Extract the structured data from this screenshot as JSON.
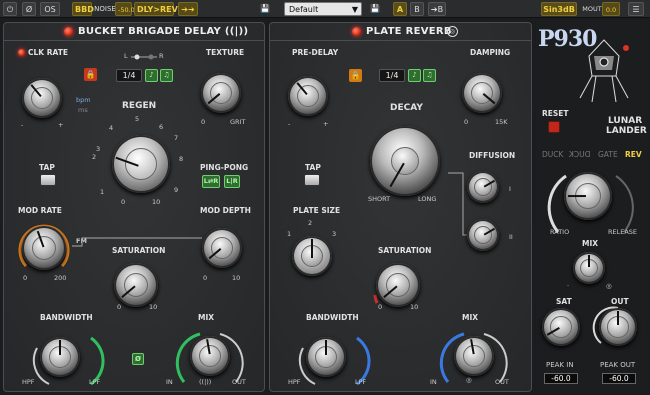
{
  "topbar": {
    "power": "⏻",
    "phase": "Ø",
    "os": "OS",
    "bbd": "BBD",
    "noise_label": "NOISE",
    "noise_value": "-50.0",
    "dly_rev": "DLY>REV",
    "routing": "➔➔",
    "save": "💾",
    "preset": "Default",
    "preset_arrow": "▼",
    "save2": "💾",
    "a": "A",
    "b": "B",
    "ab": "➔B",
    "sin": "Sin3dB",
    "mout_label": "MOUT",
    "mout_value": "0.0"
  },
  "bbd": {
    "title": "BUCKET BRIGADE DELAY ((|))",
    "clk_rate": "CLK RATE",
    "l": "L",
    "r": "R",
    "sync_value": "1/4",
    "texture": "TEXTURE",
    "texture_min": "0",
    "texture_max": "GRIT",
    "bpm": "bpm",
    "ms": "ms",
    "minus": "-",
    "plus": "+",
    "regen": "REGEN",
    "regen_ticks": [
      "0",
      "1",
      "2",
      "3",
      "4",
      "5",
      "6",
      "7",
      "8",
      "9",
      "10"
    ],
    "tap": "TAP",
    "ping_pong": "PING-PONG",
    "lr": "L⇄R",
    "lr2": "L|R",
    "mod_rate": "MOD RATE",
    "mod_rate_min": "0",
    "mod_rate_max": "200",
    "fm": "FM",
    "mod_depth": "MOD DEPTH",
    "mod_depth_min": "0",
    "mod_depth_max": "10",
    "saturation": "SATURATION",
    "sat_min": "0",
    "sat_max": "10",
    "bandwidth": "BANDWIDTH",
    "hpf": "HPF",
    "lpf": "LPF",
    "mix": "MIX",
    "mix_in": "IN",
    "mix_out": "OUT",
    "mix_mid": "((|))",
    "phase_btn": "Ø"
  },
  "plate": {
    "title": "PLATE REVERB",
    "pre_delay": "PRE-DELAY",
    "sync_value": "1/4",
    "damping": "DAMPING",
    "damp_min": "0",
    "damp_max": "15K",
    "decay": "DECAY",
    "short": "SHORT",
    "long": "LONG",
    "tap": "TAP",
    "diffusion": "DIFFUSION",
    "diff1": "I",
    "diff2": "II",
    "plate_size": "PLATE SIZE",
    "size_ticks": [
      "1",
      "2",
      "3"
    ],
    "saturation": "SATURATION",
    "sat_min": "0",
    "sat_max": "10",
    "bandwidth": "BANDWIDTH",
    "hpf": "HPF",
    "lpf": "LPF",
    "mix": "MIX",
    "mix_in": "IN",
    "mix_out": "OUT",
    "minus": "-",
    "plus": "+"
  },
  "side": {
    "logo": "P930",
    "brand1": "LUNAR",
    "brand2": "LANDER",
    "reset": "RESET",
    "modes": [
      "DUCK",
      "DUCK",
      "GATE",
      "REV"
    ],
    "ratio": "RATIO",
    "release": "RELEASE",
    "mix": "MIX",
    "sat": "SAT",
    "out": "OUT",
    "peak_in": "PEAK IN",
    "peak_in_val": "-60.0",
    "peak_out": "PEAK OUT",
    "peak_out_val": "-60.0"
  }
}
